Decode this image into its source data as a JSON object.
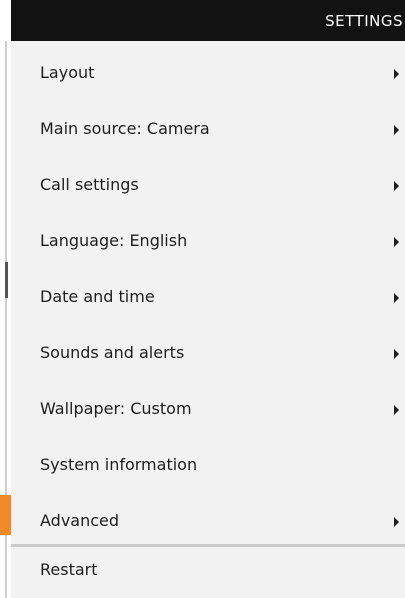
{
  "header": {
    "title": "SETTINGS"
  },
  "menu": {
    "items": [
      {
        "label": "Layout",
        "has_submenu": true
      },
      {
        "label": "Main source: Camera",
        "has_submenu": true
      },
      {
        "label": "Call settings",
        "has_submenu": true
      },
      {
        "label": "Language: English",
        "has_submenu": true
      },
      {
        "label": "Date and time",
        "has_submenu": true
      },
      {
        "label": "Sounds and alerts",
        "has_submenu": true
      },
      {
        "label": "Wallpaper: Custom",
        "has_submenu": true
      },
      {
        "label": "System information",
        "has_submenu": false
      },
      {
        "label": "Advanced",
        "has_submenu": true,
        "selected": true
      },
      {
        "label": "Restart",
        "has_submenu": false
      }
    ],
    "selected_index": 8
  },
  "colors": {
    "header_bg": "#121212",
    "menu_bg": "#f2f2f2",
    "selection_accent": "#f08a2a",
    "text": "#1e1e1e"
  },
  "icons": {
    "submenu": "chevron-right-icon"
  }
}
